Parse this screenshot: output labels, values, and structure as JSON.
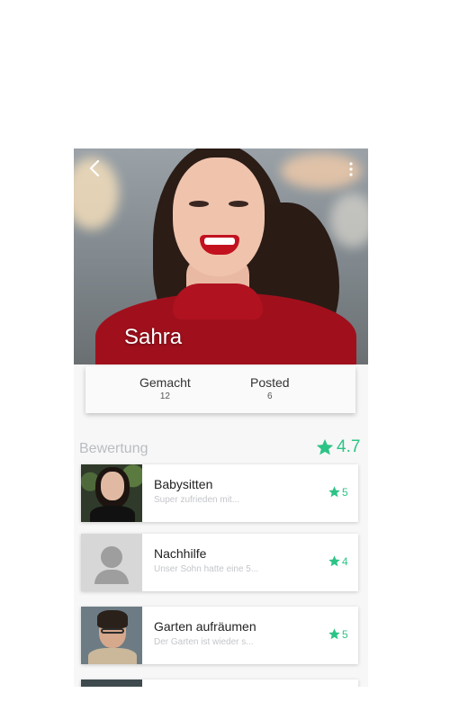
{
  "profile": {
    "name": "Sahra",
    "back_icon": "chevron-left-icon",
    "menu_icon": "more-vertical-icon"
  },
  "stats": {
    "done_label": "Gemacht",
    "done_value": "12",
    "posted_label": "Posted",
    "posted_value": "6"
  },
  "reviews": {
    "title": "Bewertung",
    "average": "4.7",
    "accent": "#2cc486",
    "items": [
      {
        "title": "Babysitten",
        "snippet": "Super zufrieden mit...",
        "rating": "5"
      },
      {
        "title": "Nachhilfe",
        "snippet": "Unser Sohn hatte eine 5...",
        "rating": "4"
      },
      {
        "title": "Garten aufräumen",
        "snippet": "Der Garten ist wieder s...",
        "rating": "5"
      }
    ]
  }
}
